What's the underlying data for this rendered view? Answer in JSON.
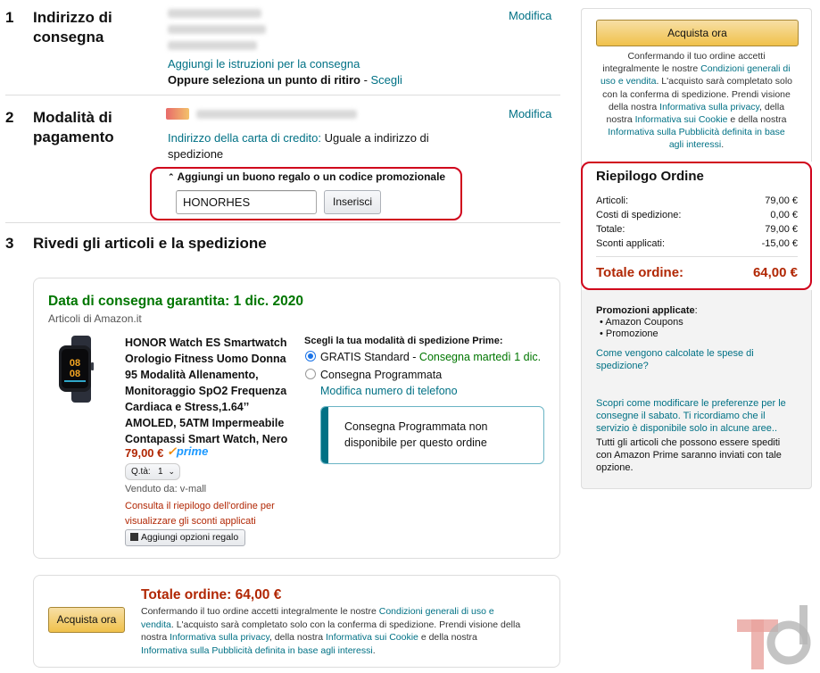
{
  "step1": {
    "number": "1",
    "title_line1": "Indirizzo di",
    "title_line2": "consegna",
    "edit": "Modifica",
    "add_instructions": "Aggiungi le istruzioni per la consegna",
    "pickup_prefix": "Oppure seleziona un punto di ritiro",
    "pickup_sep": " - ",
    "pickup_link": "Scegli"
  },
  "step2": {
    "number": "2",
    "title_line1": "Modalità di",
    "title_line2": "pagamento",
    "edit": "Modifica",
    "billing_label": "Indirizzo della carta di credito:",
    "billing_value_1": "Uguale a indirizzo di",
    "billing_value_2": "spedizione",
    "promo_toggle": "Aggiungi un buono regalo o un codice promozionale",
    "promo_value": "HONORHES",
    "promo_button": "Inserisci"
  },
  "step3": {
    "number": "3",
    "title": "Rivedi gli articoli e la spedizione",
    "delivery_date": "Data di consegna garantita: 1 dic. 2020",
    "seller_line": "Articoli di Amazon.it",
    "product_title": [
      "HONOR Watch ES Smartwatch",
      "Orologio Fitness Uomo Donna",
      "95 Modalità Allenamento,",
      "Monitoraggio SpO2 Frequenza",
      "Cardiaca e Stress,1.64’’",
      "AMOLED, 5ATM Impermeabile",
      "Contapassi Smart Watch, Nero"
    ],
    "price": "79,00 €",
    "prime": "prime",
    "qty_label": "Q.tà:",
    "qty_value": "1",
    "sold_by": "Venduto da: v-mall",
    "promo_note_1": "Consulta il riepilogo dell'ordine per",
    "promo_note_2": "visualizzare gli sconti applicati",
    "gift_button": "Aggiungi opzioni regalo",
    "shipping_heading": "Scegli la tua modalità di spedizione Prime:",
    "option1_label": "GRATIS Standard",
    "option1_sep": " - ",
    "option1_detail": "Consegna martedì 1 dic.",
    "option2_label": "Consegna Programmata",
    "edit_phone": "Modifica numero di telefono",
    "info_box_1": "Consegna Programmata non",
    "info_box_2": "disponibile per questo ordine"
  },
  "bottom": {
    "button": "Acquista ora",
    "total_label": "Totale ordine:",
    "total_value": "64,00 €",
    "legal": [
      [
        [
          "Confermando il tuo ordine accetti integralmente le nostre ",
          "t"
        ],
        [
          "Condizioni generali di uso e",
          "l"
        ]
      ],
      [
        [
          "vendita",
          "l"
        ],
        [
          ". L'acquisto sarà completato solo con la conferma di spedizione. Prendi visione della",
          "t"
        ]
      ],
      [
        [
          "nostra ",
          "t"
        ],
        [
          "Informativa sulla privacy",
          "l"
        ],
        [
          ", della nostra ",
          "t"
        ],
        [
          "Informativa sui Cookie",
          "l"
        ],
        [
          " e della nostra",
          "t"
        ]
      ],
      [
        [
          "Informativa sulla Pubblicità definita in base agli interessi",
          "l"
        ],
        [
          ".",
          "t"
        ]
      ]
    ]
  },
  "sidebar": {
    "button": "Acquista ora",
    "legal": [
      [
        [
          "Confermando il tuo ordine accetti",
          "t"
        ]
      ],
      [
        [
          "integralmente le nostre ",
          "t"
        ],
        [
          "Condizioni generali di",
          "l"
        ]
      ],
      [
        [
          "uso e vendita",
          "l"
        ],
        [
          ". L'acquisto sarà completato solo",
          "t"
        ]
      ],
      [
        [
          "con la conferma di spedizione. Prendi visione",
          "t"
        ]
      ],
      [
        [
          "della nostra ",
          "t"
        ],
        [
          "Informativa sulla privacy",
          "l"
        ],
        [
          ", della",
          "t"
        ]
      ],
      [
        [
          "nostra ",
          "t"
        ],
        [
          "Informativa sui Cookie",
          "l"
        ],
        [
          " e della nostra",
          "t"
        ]
      ],
      [
        [
          "Informativa sulla Pubblicità definita in base",
          "l"
        ]
      ],
      [
        [
          "agli interessi",
          "l"
        ],
        [
          ".",
          "t"
        ]
      ]
    ],
    "summary_title": "Riepilogo Ordine",
    "rows": [
      {
        "label": "Articoli:",
        "value": "79,00 €"
      },
      {
        "label": "Costi di spedizione:",
        "value": "0,00 €"
      },
      {
        "label": "Totale:",
        "value": "79,00 €"
      },
      {
        "label": "Sconti applicati:",
        "value": "-15,00 €"
      }
    ],
    "total_label": "Totale ordine:",
    "total_value": "64,00 €",
    "promos_title": "Promozioni applicate",
    "promos_colon": ":",
    "promos": [
      "Amazon Coupons",
      "Promozione"
    ],
    "shipping_calc_1": "Come vengono calcolate le spese di",
    "shipping_calc_2": "spedizione?",
    "saturday_1": "Scopri come modificare le preferenze per le",
    "saturday_2": "consegne il sabato. Ti ricordiamo che il",
    "saturday_3": "servizio è disponibile solo in alcune aree..",
    "prime_note_1": "Tutti gli articoli che possono essere spediti",
    "prime_note_2": "con Amazon Prime saranno inviati con tale",
    "prime_note_3": "opzione."
  },
  "colors": {
    "link": "#007185",
    "price_red": "#b12704",
    "delivery_green": "#007600",
    "highlight_red": "#d0021b",
    "button_yellow": "#f0c14b"
  }
}
